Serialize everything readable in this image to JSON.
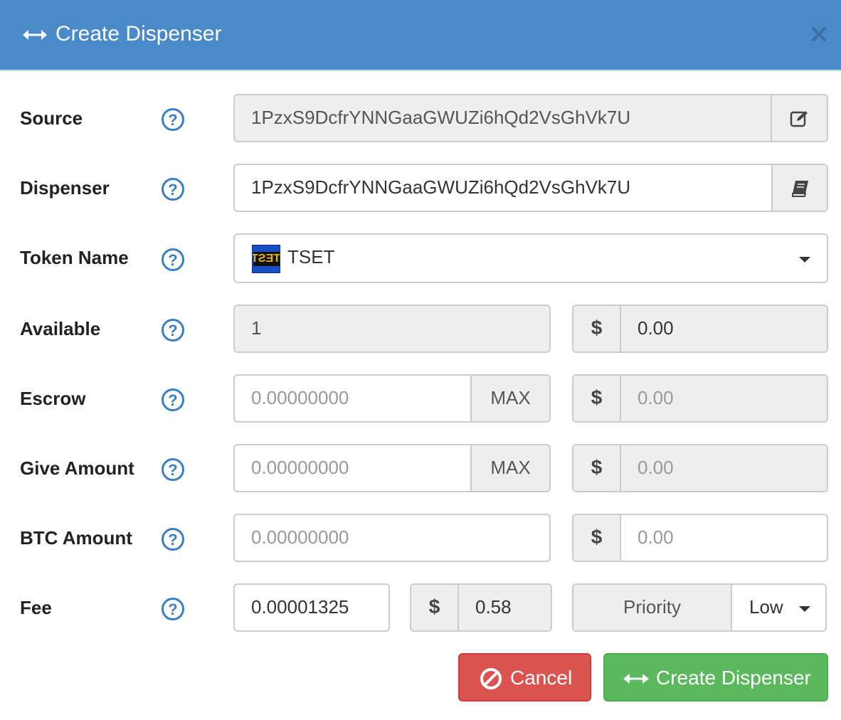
{
  "dialog": {
    "title": "Create Dispenser",
    "header_color": "#4a8ac9"
  },
  "form": {
    "source": {
      "label": "Source",
      "value": "1PzxS9DcfrYNNGaaGWUZi6hQd2VsGhVk7U",
      "addon_icon": "edit-icon"
    },
    "dispenser": {
      "label": "Dispenser",
      "value": "1PzxS9DcfrYNNGaaGWUZi6hQd2VsGhVk7U",
      "addon_icon": "address-book-icon"
    },
    "token": {
      "label": "Token Name",
      "selected": "TSET",
      "image_text": "TEST"
    },
    "available": {
      "label": "Available",
      "value": "1",
      "currency": "$",
      "usd": "0.00"
    },
    "escrow": {
      "label": "Escrow",
      "placeholder": "0.00000000",
      "max_label": "MAX",
      "currency": "$",
      "usd_placeholder": "0.00"
    },
    "give_amount": {
      "label": "Give Amount",
      "placeholder": "0.00000000",
      "max_label": "MAX",
      "currency": "$",
      "usd_placeholder": "0.00"
    },
    "btc_amount": {
      "label": "BTC Amount",
      "placeholder": "0.00000000",
      "currency": "$",
      "usd_placeholder": "0.00"
    },
    "fee": {
      "label": "Fee",
      "value": "0.00001325",
      "currency": "$",
      "usd": "0.58",
      "priority_label": "Priority",
      "priority_value": "Low"
    }
  },
  "buttons": {
    "cancel": "Cancel",
    "create": "Create Dispenser",
    "cancel_color": "#d9534f",
    "create_color": "#5cb85c"
  },
  "icons": {
    "help": "question-circle-icon",
    "accent": "#3a7fc1"
  }
}
